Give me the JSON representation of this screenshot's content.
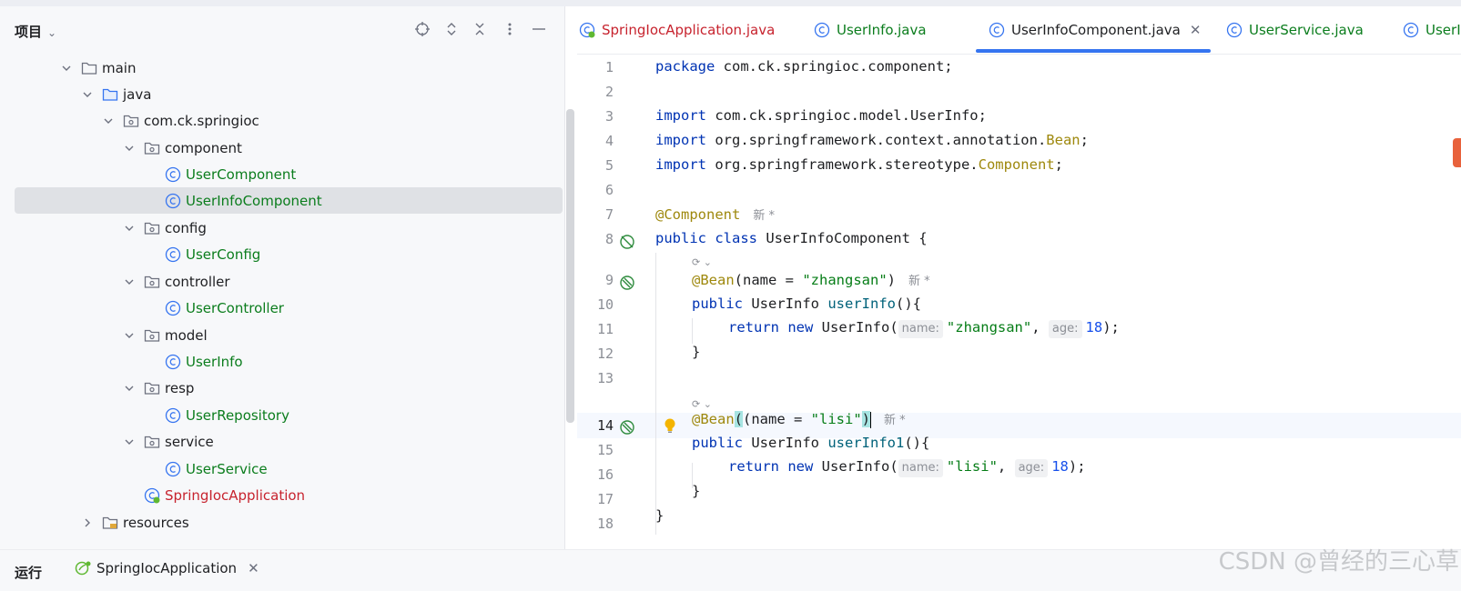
{
  "project_panel": {
    "title": "项目",
    "tree": [
      {
        "label": "main",
        "kind": "folder"
      },
      {
        "label": "java",
        "kind": "source-folder"
      },
      {
        "label": "com.ck.springioc",
        "kind": "package"
      },
      {
        "label": "component",
        "kind": "package"
      },
      {
        "label": "UserComponent",
        "kind": "class"
      },
      {
        "label": "UserInfoComponent",
        "kind": "class",
        "selected": true
      },
      {
        "label": "config",
        "kind": "package"
      },
      {
        "label": "UserConfig",
        "kind": "class"
      },
      {
        "label": "controller",
        "kind": "package"
      },
      {
        "label": "UserController",
        "kind": "class"
      },
      {
        "label": "model",
        "kind": "package"
      },
      {
        "label": "UserInfo",
        "kind": "class"
      },
      {
        "label": "resp",
        "kind": "package"
      },
      {
        "label": "UserRepository",
        "kind": "class"
      },
      {
        "label": "service",
        "kind": "package"
      },
      {
        "label": "UserService",
        "kind": "class"
      },
      {
        "label": "SpringIocApplication",
        "kind": "app-class"
      },
      {
        "label": "resources",
        "kind": "resources"
      }
    ]
  },
  "editor": {
    "tabs": [
      {
        "label": "SpringIocApplication.java",
        "kind": "app"
      },
      {
        "label": "UserInfo.java",
        "kind": "class"
      },
      {
        "label": "UserInfoComponent.java",
        "kind": "class",
        "active": true
      },
      {
        "label": "UserService.java",
        "kind": "class"
      },
      {
        "label": "UserI",
        "kind": "class"
      }
    ],
    "current_line": "14",
    "code": {
      "l1_kw": "package",
      "l1_rest": " com.ck.springioc.component;",
      "l3_kw": "import",
      "l3_rest": " com.ck.springioc.model.UserInfo;",
      "l4_kw": "import",
      "l4_rest": " org.springframework.context.annotation.",
      "l4_ann": "Bean",
      "l4_end": ";",
      "l5_kw": "import",
      "l5_rest": " org.springframework.stereotype.",
      "l5_ann": "Component",
      "l5_end": ";",
      "l7_ann": "@Component",
      "l7_new": "新 *",
      "l8_kw": "public class",
      "l8_rest": " UserInfoComponent {",
      "l9_ann": "@Bean",
      "l9_a": "(name = ",
      "l9_str": "\"zhangsan\"",
      "l9_b": ")",
      "l9_new": "新 *",
      "l10_kw": "public",
      "l10_a": " UserInfo ",
      "l10_fn": "userInfo",
      "l10_b": "(){",
      "l11_kw": "return new",
      "l11_a": " UserInfo(",
      "l11_hint1": "name:",
      "l11_str": "\"zhangsan\"",
      "l11_b": ", ",
      "l11_hint2": "age:",
      "l11_num": "18",
      "l11_c": ");",
      "l12": "}",
      "l14_ann": "@Bean",
      "l14_a": "(name = ",
      "l14_str": "\"lisi\"",
      "l14_b": ")",
      "l14_new": "新 *",
      "l15_kw": "public",
      "l15_a": " UserInfo ",
      "l15_fn": "userInfo1",
      "l15_b": "(){",
      "l16_kw": "return new",
      "l16_a": " UserInfo(",
      "l16_hint1": "name:",
      "l16_str": "\"lisi\"",
      "l16_b": ", ",
      "l16_hint2": "age:",
      "l16_num": "18",
      "l16_c": ");",
      "l17": "}",
      "l18": "}"
    },
    "line_numbers": [
      "1",
      "2",
      "3",
      "4",
      "5",
      "6",
      "7",
      "8",
      "9",
      "10",
      "11",
      "12",
      "13",
      "14",
      "15",
      "16",
      "17",
      "18"
    ]
  },
  "bottom_bar": {
    "run_label": "运行",
    "run_tab": "SpringIocApplication"
  },
  "watermark": "CSDN @曾经的三心草",
  "colors": {
    "accent": "#3574f0",
    "class_name": "#0b7d1d",
    "app_name": "#c7232e",
    "keyword": "#0033b3",
    "annotation": "#9e880d",
    "string": "#067d17",
    "number": "#1750eb"
  }
}
